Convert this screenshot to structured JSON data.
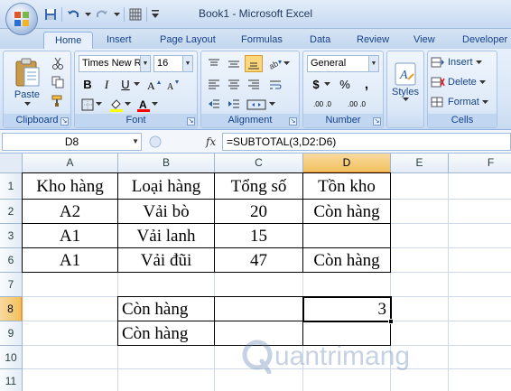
{
  "window": {
    "title": "Book1 - Microsoft Excel"
  },
  "tabs": [
    "Home",
    "Insert",
    "Page Layout",
    "Formulas",
    "Data",
    "Review",
    "View",
    "Developer"
  ],
  "ribbon": {
    "clipboard": {
      "label": "Clipboard",
      "paste": "Paste"
    },
    "font": {
      "label": "Font",
      "name": "Times New Ro",
      "size": "16",
      "bold": "B",
      "italic": "I",
      "underline": "U"
    },
    "alignment": {
      "label": "Alignment"
    },
    "number": {
      "label": "Number",
      "format": "General",
      "currency": "$",
      "percent": "%",
      "comma": ",",
      "dec_more": ".00 .0",
      "dec_less": ".00 .0"
    },
    "styles": {
      "label": "Styles"
    },
    "cells": {
      "label": "Cells",
      "insert": "Insert",
      "delete": "Delete",
      "format": "Format"
    }
  },
  "formula_bar": {
    "name_box": "D8",
    "fx": "fx",
    "formula": "=SUBTOTAL(3,D2:D6)"
  },
  "sheet": {
    "columns": [
      "A",
      "B",
      "C",
      "D",
      "E",
      "F"
    ],
    "rows": [
      {
        "num": "1",
        "cells": [
          "Kho hàng",
          "Loại hàng",
          "Tổng số",
          "Tồn kho",
          "",
          ""
        ]
      },
      {
        "num": "2",
        "cells": [
          "A2",
          "Vải bò",
          "20",
          "Còn hàng",
          "",
          ""
        ]
      },
      {
        "num": "3",
        "cells": [
          "A1",
          "Vải lanh",
          "15",
          "",
          "",
          ""
        ]
      },
      {
        "num": "6",
        "cells": [
          "A1",
          "Vải đũi",
          "47",
          "Còn hàng",
          "",
          ""
        ]
      },
      {
        "num": "7",
        "cells": [
          "",
          "",
          "",
          "",
          "",
          ""
        ]
      },
      {
        "num": "8",
        "cells": [
          "",
          "Còn hàng",
          "",
          "3",
          "",
          ""
        ]
      },
      {
        "num": "9",
        "cells": [
          "",
          "Còn hàng",
          "",
          "",
          "",
          ""
        ]
      },
      {
        "num": "10",
        "cells": [
          "",
          "",
          "",
          "",
          "",
          ""
        ]
      },
      {
        "num": "11",
        "cells": [
          "",
          "",
          "",
          "",
          "",
          ""
        ]
      }
    ],
    "selected_cell": "D8"
  },
  "watermark": {
    "text": "uantrimang"
  },
  "colors": {
    "accent": "#15428b",
    "selected_header": "#f1c15f",
    "ribbon": "#dbe7f7"
  }
}
